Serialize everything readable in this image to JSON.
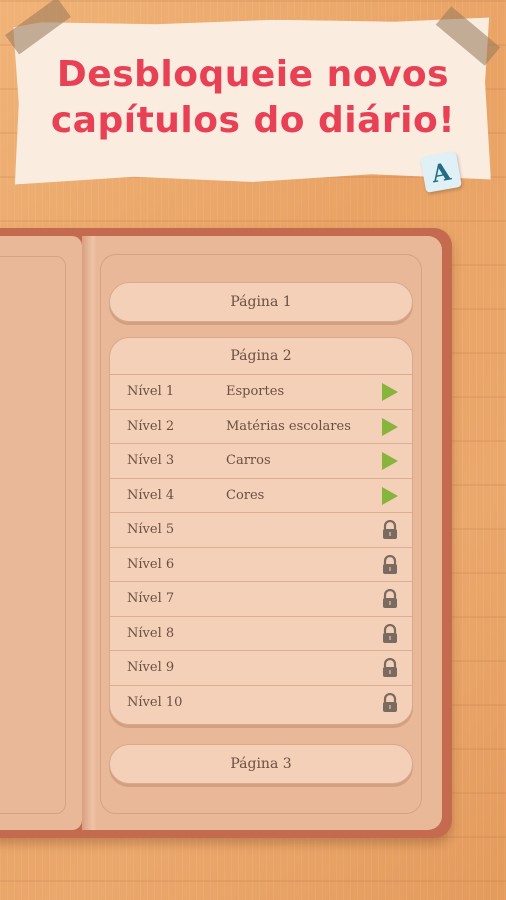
{
  "banner": {
    "headline_line1": "Desbloqueie novos",
    "headline_line2": "capítulos do diário!"
  },
  "letter_tile": "A",
  "diary": {
    "page1_label": "Página 1",
    "page2_label": "Página 2",
    "page3_label": "Página 3",
    "levels": [
      {
        "label": "Nível 1",
        "category": "Esportes",
        "state": "unlocked",
        "icon": "play-icon"
      },
      {
        "label": "Nível 2",
        "category": "Matérias escolares",
        "state": "unlocked",
        "icon": "play-icon"
      },
      {
        "label": "Nível 3",
        "category": "Carros",
        "state": "unlocked",
        "icon": "play-icon"
      },
      {
        "label": "Nível 4",
        "category": "Cores",
        "state": "unlocked",
        "icon": "play-icon"
      },
      {
        "label": "Nível 5",
        "category": "",
        "state": "locked",
        "icon": "lock-icon"
      },
      {
        "label": "Nível 6",
        "category": "",
        "state": "locked",
        "icon": "lock-icon"
      },
      {
        "label": "Nível 7",
        "category": "",
        "state": "locked",
        "icon": "lock-icon"
      },
      {
        "label": "Nível 8",
        "category": "",
        "state": "locked",
        "icon": "lock-icon"
      },
      {
        "label": "Nível 9",
        "category": "",
        "state": "locked",
        "icon": "lock-icon"
      },
      {
        "label": "Nível 10",
        "category": "",
        "state": "locked",
        "icon": "lock-icon"
      }
    ]
  },
  "colors": {
    "headline": "#e84156",
    "play": "#87b43b",
    "lock": "#7a6a60"
  }
}
